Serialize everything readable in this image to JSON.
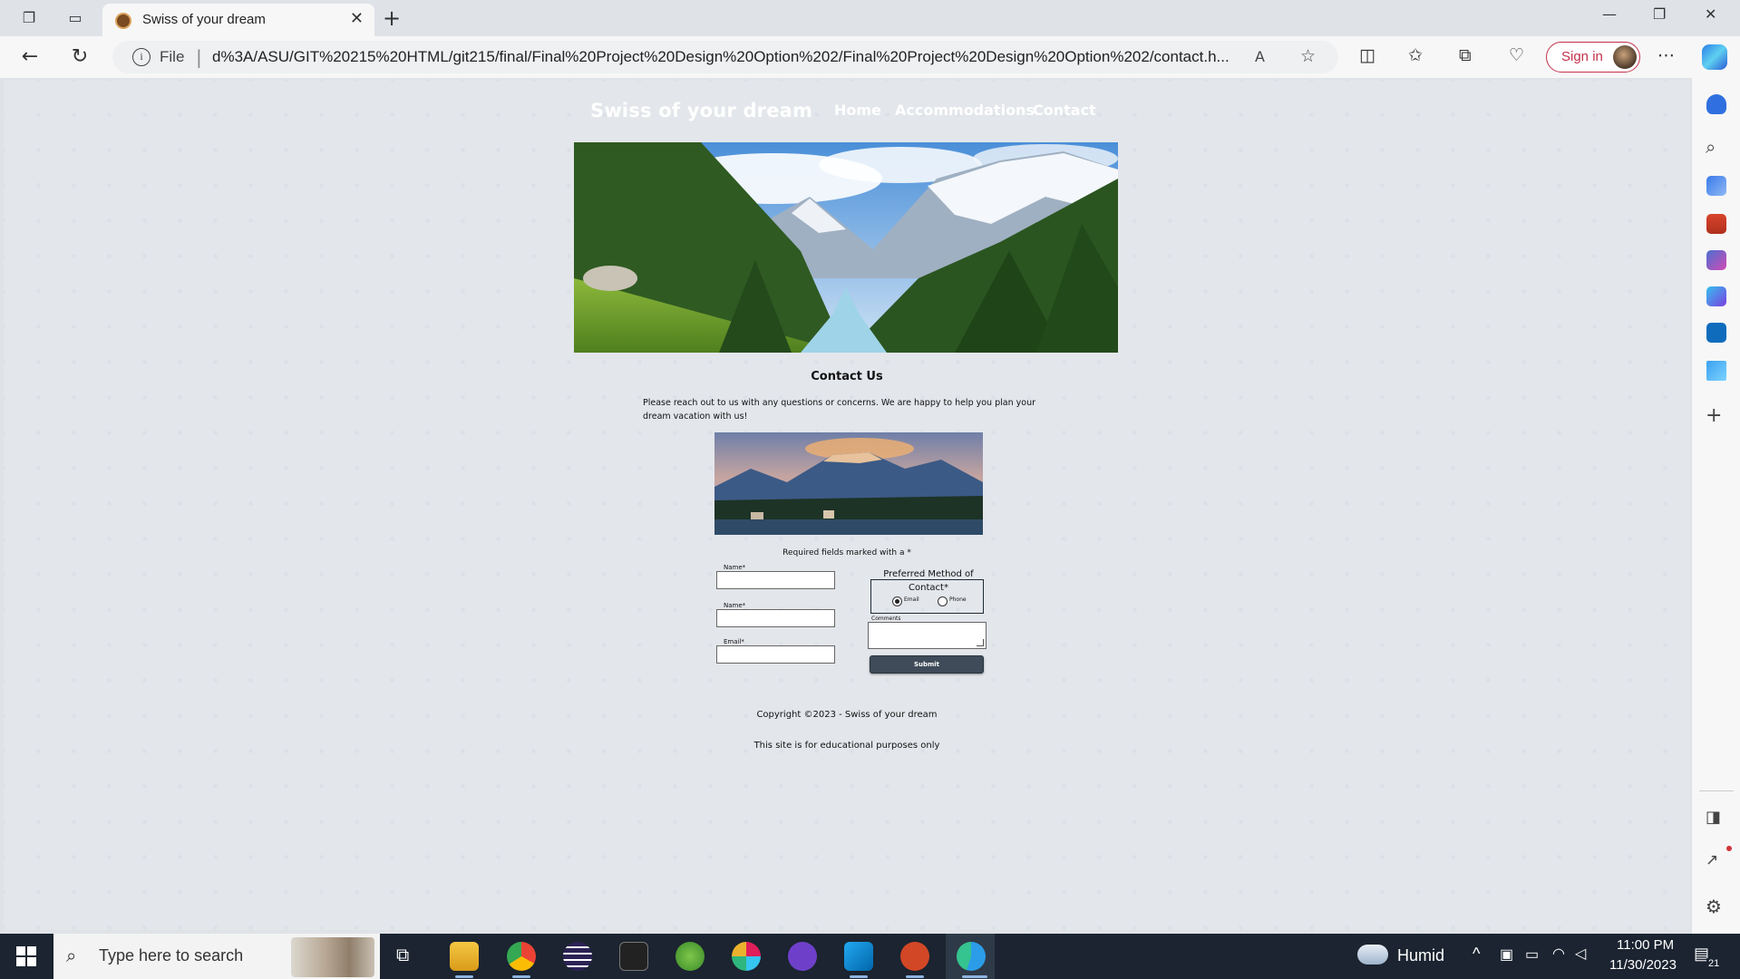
{
  "browser": {
    "tab_title": "Swiss of your dream",
    "file_label": "File",
    "url": "d%3A/ASU/GIT%20215%20HTML/git215/final/Final%20Project%20Design%20Option%202/Final%20Project%20Design%20Option%202/contact.h...",
    "signin_label": "Sign in"
  },
  "site": {
    "title": "Swiss of your dream",
    "nav": [
      "Home",
      "Accommodations",
      "Contact"
    ],
    "heading": "Contact Us",
    "intro": "Please reach out to us with any questions or concerns. We are happy to help you plan your dream vacation with us!",
    "required_note": "Required fields marked with a *",
    "form": {
      "first_name_label": "Name*",
      "last_name_label": "Name*",
      "email_label": "Email*",
      "contact_legend": "Preferred Method of Contact*",
      "radio_email": "Email",
      "radio_phone": "Phone",
      "selected_method": "Email",
      "comments_label": "Comments",
      "submit_label": "Submit"
    },
    "footer_copyright": "Copyright ©2023 - Swiss of your dream",
    "footer_note": "This site is for educational purposes only"
  },
  "taskbar": {
    "search_placeholder": "Type here to search",
    "weather": "Humid",
    "time": "11:00 PM",
    "date": "11/30/2023",
    "notification_count": "21"
  }
}
